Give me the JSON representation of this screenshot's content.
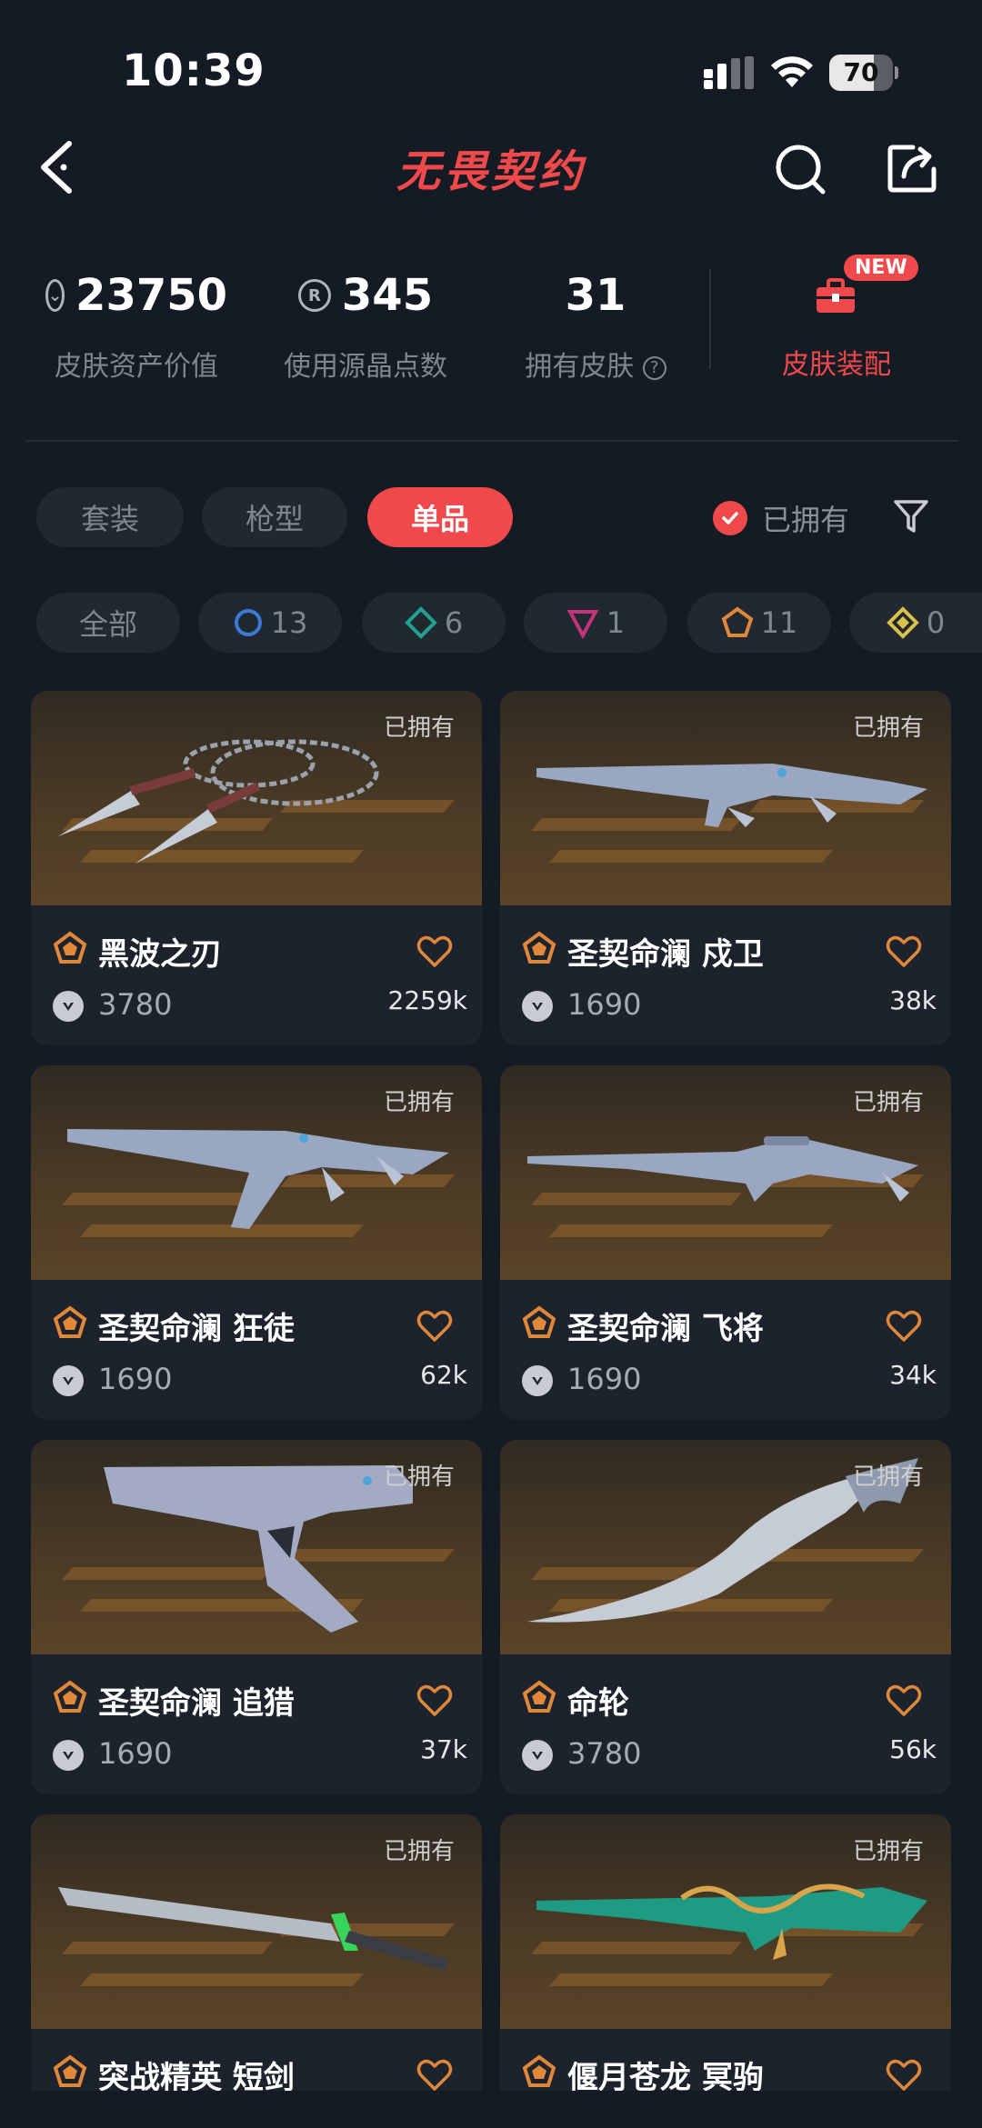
{
  "status_bar": {
    "time": "10:39",
    "battery": "70",
    "battery_level": 0.7
  },
  "header": {
    "title": "无畏契约",
    "back_icon": "back-arrow-icon",
    "search_icon": "search-icon",
    "share_icon": "share-icon"
  },
  "stats": {
    "asset_value": "23750",
    "asset_label": "皮肤资产价值",
    "radianite_points": "345",
    "radianite_label": "使用源晶点数",
    "skins_owned": "31",
    "skins_owned_label": "拥有皮肤",
    "loadout_label": "皮肤装配",
    "loadout_badge": "NEW"
  },
  "tabs": [
    {
      "label": "套装",
      "active": false
    },
    {
      "label": "枪型",
      "active": false
    },
    {
      "label": "单品",
      "active": true
    }
  ],
  "owned_filter": {
    "label": "已拥有",
    "checked": true
  },
  "rarity_filters": [
    {
      "label": "全部",
      "count": ""
    },
    {
      "label": "",
      "count": "13",
      "color": "#3a7bd5",
      "shape": "circle"
    },
    {
      "label": "",
      "count": "6",
      "color": "#1fa38f",
      "shape": "diamond"
    },
    {
      "label": "",
      "count": "1",
      "color": "#c2357a",
      "shape": "triangle"
    },
    {
      "label": "",
      "count": "11",
      "color": "#e0873a",
      "shape": "pentagon"
    },
    {
      "label": "",
      "count": "0",
      "color": "#d8c04a",
      "shape": "diamond"
    }
  ],
  "cards": [
    {
      "owned": "已拥有",
      "name": "黑波之刃",
      "price": "3780",
      "likes": "2259k"
    },
    {
      "owned": "已拥有",
      "name": "圣契命澜 戍卫",
      "price": "1690",
      "likes": "38k"
    },
    {
      "owned": "已拥有",
      "name": "圣契命澜 狂徒",
      "price": "1690",
      "likes": "62k"
    },
    {
      "owned": "已拥有",
      "name": "圣契命澜 飞将",
      "price": "1690",
      "likes": "34k"
    },
    {
      "owned": "已拥有",
      "name": "圣契命澜 追猎",
      "price": "1690",
      "likes": "37k"
    },
    {
      "owned": "已拥有",
      "name": "命轮",
      "price": "3780",
      "likes": "56k"
    },
    {
      "owned": "已拥有",
      "name": "突战精英 短剑",
      "price": "",
      "likes": ""
    },
    {
      "owned": "已拥有",
      "name": "偃月苍龙 冥驹",
      "price": "",
      "likes": ""
    }
  ],
  "colors": {
    "accent": "#f0494b",
    "background": "#151b24",
    "card": "#1c232c",
    "tier_orange": "#e0873a"
  }
}
